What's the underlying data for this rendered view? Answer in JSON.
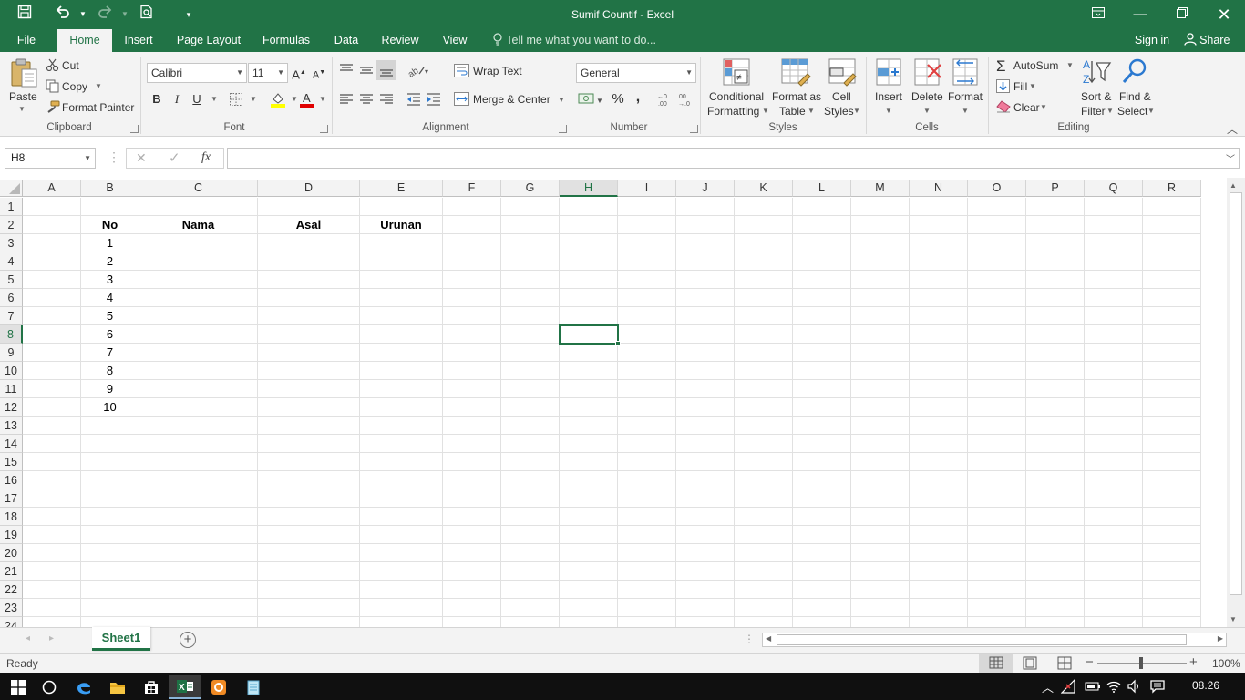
{
  "titlebar": {
    "title": "Sumif Countif - Excel"
  },
  "tabs": [
    "File",
    "Home",
    "Insert",
    "Page Layout",
    "Formulas",
    "Data",
    "Review",
    "View"
  ],
  "active_tab": "Home",
  "tell_me": "Tell me what you want to do...",
  "account": {
    "signin": "Sign in",
    "share": "Share"
  },
  "ribbon": {
    "clipboard": {
      "label": "Clipboard",
      "paste": "Paste",
      "cut": "Cut",
      "copy": "Copy",
      "format_painter": "Format Painter"
    },
    "font": {
      "label": "Font",
      "family": "Calibri",
      "size": "11",
      "bold": "B",
      "italic": "I",
      "underline": "U"
    },
    "alignment": {
      "label": "Alignment",
      "wrap": "Wrap Text",
      "merge": "Merge & Center"
    },
    "number": {
      "label": "Number",
      "format": "General",
      "percent": "%",
      "comma": ","
    },
    "styles": {
      "label": "Styles",
      "cond1": "Conditional",
      "cond2": "Formatting",
      "fmt1": "Format as",
      "fmt2": "Table",
      "cell1": "Cell",
      "cell2": "Styles"
    },
    "cells": {
      "label": "Cells",
      "insert": "Insert",
      "delete": "Delete",
      "format": "Format"
    },
    "editing": {
      "label": "Editing",
      "autosum": "AutoSum",
      "fill": "Fill",
      "clear": "Clear",
      "sort1": "Sort &",
      "sort2": "Filter",
      "find1": "Find &",
      "find2": "Select"
    }
  },
  "formula_bar": {
    "name_box": "H8",
    "fx": "fx",
    "value": ""
  },
  "columns": [
    "A",
    "B",
    "C",
    "D",
    "E",
    "F",
    "G",
    "H",
    "I",
    "J",
    "K",
    "L",
    "M",
    "N",
    "O",
    "P",
    "Q",
    "R"
  ],
  "rows": [
    "1",
    "2",
    "3",
    "4",
    "5",
    "6",
    "7",
    "8",
    "9",
    "10",
    "11",
    "12",
    "13",
    "14",
    "15",
    "16",
    "17",
    "18",
    "19",
    "20",
    "21",
    "22",
    "23",
    "24"
  ],
  "cells": {
    "B2": "No",
    "C2": "Nama",
    "D2": "Asal",
    "E2": "Urunan",
    "B3": "1",
    "B4": "2",
    "B5": "3",
    "B6": "4",
    "B7": "5",
    "B8": "6",
    "B9": "7",
    "B10": "8",
    "B11": "9",
    "B12": "10"
  },
  "selected_cell": "H8",
  "sheets": [
    "Sheet1"
  ],
  "status": {
    "ready": "Ready",
    "zoom": "100%"
  },
  "taskbar": {
    "time": "08.26"
  }
}
